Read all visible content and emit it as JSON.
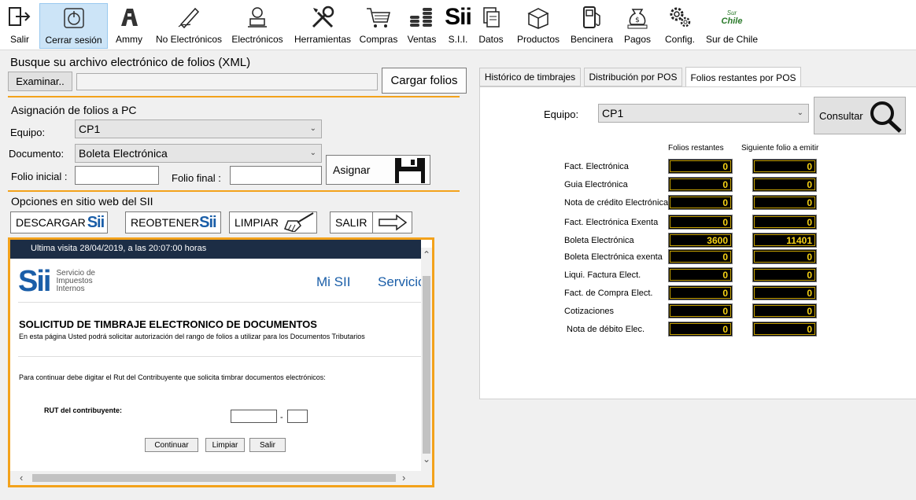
{
  "toolbar": {
    "items": [
      {
        "label": "Salir",
        "icon": "exit-icon"
      },
      {
        "label": "Cerrar sesión",
        "icon": "close-session-icon"
      },
      {
        "label": "Ammy",
        "icon": "ammy-icon"
      },
      {
        "label": "No Electrónicos",
        "icon": "pen-icon"
      },
      {
        "label": "Electrónicos",
        "icon": "user-computer-icon"
      },
      {
        "label": "Herramientas",
        "icon": "tools-icon"
      },
      {
        "label": "Compras",
        "icon": "cart-icon"
      },
      {
        "label": "Ventas",
        "icon": "coins-icon"
      },
      {
        "label": "S.I.I.",
        "icon": "sii-icon"
      },
      {
        "label": "Datos",
        "icon": "documents-icon"
      },
      {
        "label": "Productos",
        "icon": "box-icon"
      },
      {
        "label": "Bencinera",
        "icon": "fuel-pump-icon"
      },
      {
        "label": "Pagos",
        "icon": "money-bag-icon"
      },
      {
        "label": "Config.",
        "icon": "gears-icon"
      },
      {
        "label": "Sur de Chile",
        "icon": "sur-de-chile-logo"
      }
    ],
    "sur_logo_line1": "Sur",
    "sur_logo_line2": "Chile",
    "sii_text": "Sii"
  },
  "xml": {
    "title": "Busque su archivo electrónico de folios (XML)",
    "browse_label": "Examinar..",
    "path_value": "",
    "load_label": "Cargar folios"
  },
  "assign": {
    "title": "Asignación de folios a PC",
    "equipo_label": "Equipo:",
    "equipo_value": "CP1",
    "documento_label": "Documento:",
    "documento_value": "Boleta Electrónica",
    "folio_inicial_label": "Folio inicial :",
    "folio_inicial_value": "",
    "folio_final_label": "Folio final :",
    "folio_final_value": "",
    "assign_label": "Asignar"
  },
  "web_options": {
    "title": "Opciones en sitio web del SII",
    "download_label": "DESCARGAR",
    "reget_label": "REOBTENER",
    "clear_label": "LIMPIAR",
    "exit_label": "SALIR"
  },
  "web": {
    "last_visit": "Ultima visita 28/04/2019, a las 20:07:00 horas",
    "logo_big": "Sii",
    "logo_line1": "Servicio de",
    "logo_line2": "Impuestos",
    "logo_line3": "Internos",
    "nav_mi_sii": "Mi SII",
    "nav_servicios": "Servicio",
    "heading": "SOLICITUD DE TIMBRAJE ELECTRONICO DE DOCUMENTOS",
    "intro": "En esta página Usted podrá solicitar autorización del rango de folios a utilizar para los Documentos Tributarios",
    "instruction": "Para continuar debe digitar el Rut del Contribuyente que solicita timbrar documentos electrónicos:",
    "rut_label": "RUT del contribuyente:",
    "rut_value": "",
    "rut_dash": "-",
    "dv_value": "",
    "continue_label": "Continuar",
    "clear_label": "Limpiar",
    "exit_label": "Salir"
  },
  "tabs": [
    {
      "label": "Histórico de timbrajes"
    },
    {
      "label": "Distribución por POS"
    },
    {
      "label": "Folios restantes por POS"
    }
  ],
  "folios": {
    "equipo_label": "Equipo:",
    "equipo_value": "CP1",
    "consult_label": "Consultar",
    "col_remaining": "Folios restantes",
    "col_next": "Siguiente folio a emitir",
    "rows": [
      {
        "label": "Fact. Electrónica",
        "remaining": "0",
        "next": "0"
      },
      {
        "label": "Guia Electrónica",
        "remaining": "0",
        "next": "0"
      },
      {
        "label": "Nota de crédito Electrónica",
        "remaining": "0",
        "next": "0"
      },
      {
        "label": "Fact. Electrónica Exenta",
        "remaining": "0",
        "next": "0"
      },
      {
        "label": "Boleta Electrónica",
        "remaining": "3600",
        "next": "11401"
      },
      {
        "label": "Boleta Electrónica exenta",
        "remaining": "0",
        "next": "0"
      },
      {
        "label": "Liqui. Factura Elect.",
        "remaining": "0",
        "next": "0"
      },
      {
        "label": "Fact. de Compra Elect.",
        "remaining": "0",
        "next": "0"
      },
      {
        "label": "Cotizaciones",
        "remaining": "0",
        "next": "0"
      },
      {
        "label": "Nota de débito Elec.",
        "remaining": "0",
        "next": "0"
      }
    ]
  },
  "colors": {
    "accent_orange": "#f3a21b",
    "sii_blue": "#1a5ea8",
    "cell_text": "#f7d315",
    "web_header": "#1c2d45"
  }
}
